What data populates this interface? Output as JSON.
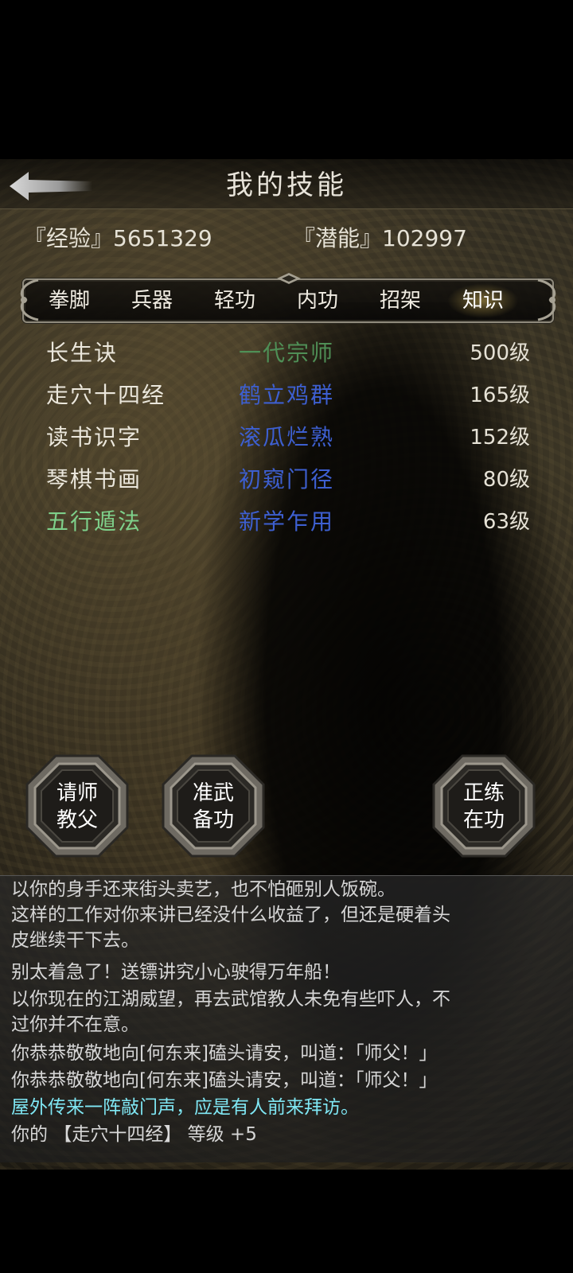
{
  "header": {
    "title": "我的技能",
    "back_icon": "back-arrow-icon"
  },
  "stats": {
    "experience": "『经验』5651329",
    "potential": "『潜能』102997"
  },
  "tabs": [
    {
      "label": "拳脚",
      "active": false
    },
    {
      "label": "兵器",
      "active": false
    },
    {
      "label": "轻功",
      "active": false
    },
    {
      "label": "内功",
      "active": false
    },
    {
      "label": "招架",
      "active": false
    },
    {
      "label": "知识",
      "active": true
    }
  ],
  "skills": [
    {
      "name": "长生诀",
      "rank": "一代宗师",
      "level": "500级",
      "name_color": "#ebe7dc",
      "rank_color": "#4f8f56"
    },
    {
      "name": "走穴十四经",
      "rank": "鹤立鸡群",
      "level": "165级",
      "name_color": "#ebe7dc",
      "rank_color": "#3d5fd0"
    },
    {
      "name": "读书识字",
      "rank": "滚瓜烂熟",
      "level": "152级",
      "name_color": "#ebe7dc",
      "rank_color": "#3d5fd0"
    },
    {
      "name": "琴棋书画",
      "rank": "初窥门径",
      "level": "80级",
      "name_color": "#ebe7dc",
      "rank_color": "#3d5fd0"
    },
    {
      "name": "五行遁法",
      "rank": "新学乍用",
      "level": "63级",
      "name_color": "#7ed08a",
      "rank_color": "#3d5fd0"
    }
  ],
  "actions": [
    {
      "line1": "请师",
      "line2": "教父"
    },
    {
      "line1": "准武",
      "line2": "备功"
    },
    {
      "line1": "正练",
      "line2": "在功"
    }
  ],
  "log": {
    "lines": [
      "以你的身手还来街头卖艺，也不怕砸别人饭碗。",
      "这样的工作对你来讲已经没什么收益了，但还是硬着头",
      "皮继续干下去。",
      "别太着急了！送镖讲究小心驶得万年船！",
      "以你现在的江湖威望，再去武馆教人未免有些吓人，不",
      "过你并不在意。",
      "你恭恭敬敬地向[何东来]磕头请安，叫道：「师父！」",
      "你恭恭敬敬地向[何东来]磕头请安，叫道：「师父！」",
      "屋外传来一阵敲门声，应是有人前来拜访。"
    ],
    "last_prefix": "你的",
    "last_skill": "【走穴十四经】",
    "last_suffix": "等级 +5"
  }
}
